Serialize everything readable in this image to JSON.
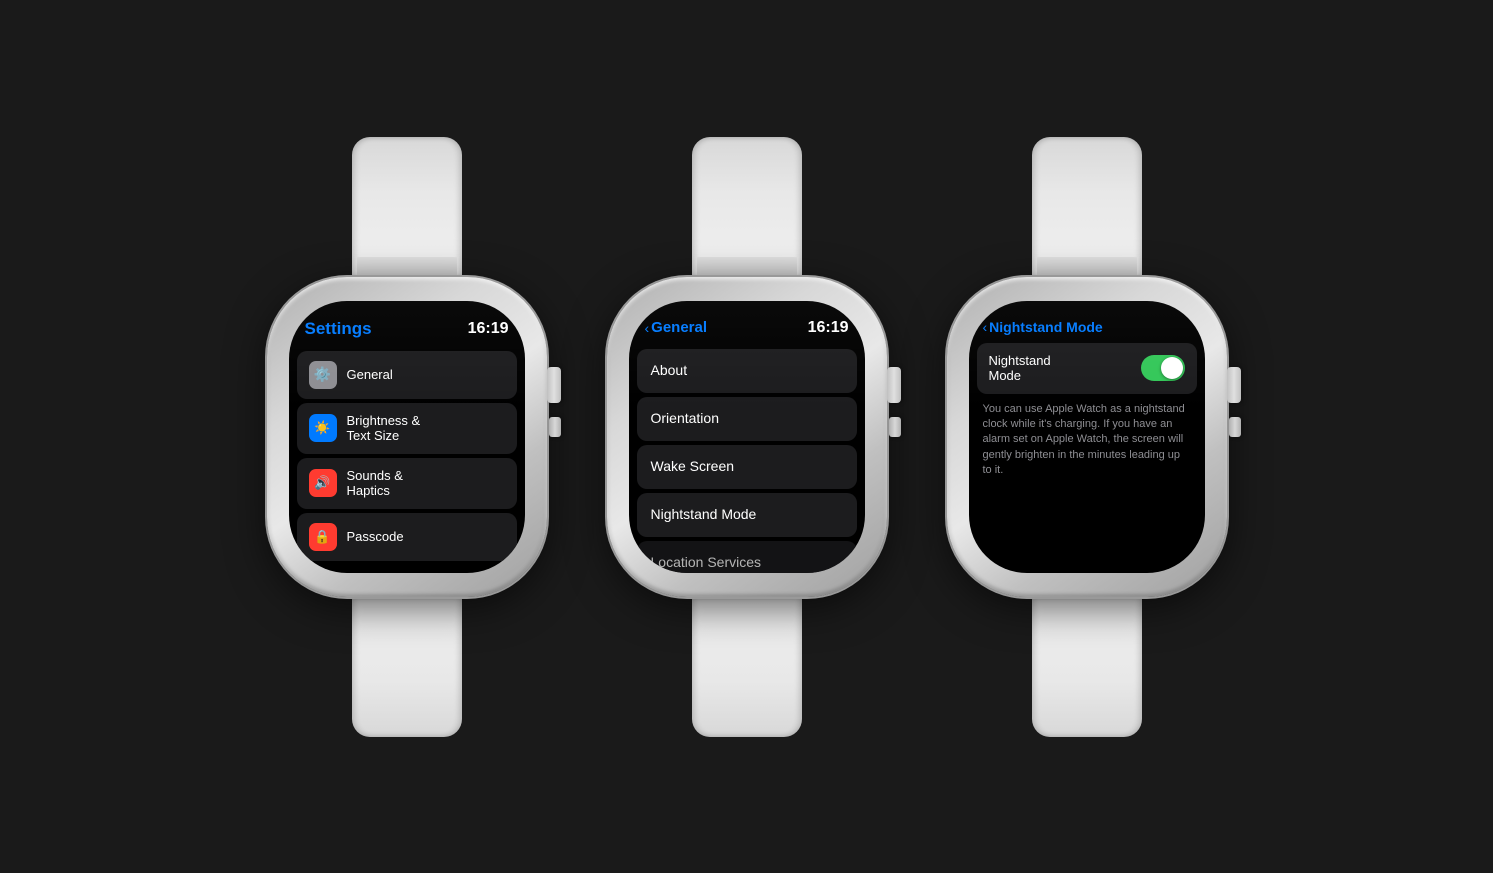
{
  "watches": [
    {
      "id": "watch-settings",
      "screen": {
        "title": "Settings",
        "titleColor": "blue",
        "showBack": false,
        "time": "16:19",
        "menuItems": [
          {
            "label": "General",
            "iconBg": "gray",
            "iconSymbol": "⚙"
          },
          {
            "label": "Brightness &\nText Size",
            "iconBg": "blue",
            "iconSymbol": "☀"
          },
          {
            "label": "Sounds &\nHaptics",
            "iconBg": "red",
            "iconSymbol": "🔊"
          },
          {
            "label": "Passcode",
            "iconBg": "red",
            "iconSymbol": "🔒"
          }
        ]
      }
    },
    {
      "id": "watch-general",
      "screen": {
        "title": "General",
        "titleColor": "blue",
        "showBack": true,
        "time": "16:19",
        "simpleMenuItems": [
          "About",
          "Orientation",
          "Wake Screen",
          "Nightstand Mode",
          "Location Services"
        ]
      }
    },
    {
      "id": "watch-nightstand",
      "screen": {
        "title": "Nightstand Mode",
        "titleColor": "blue",
        "showBack": true,
        "toggleLabel": "Nightstand\nMode",
        "toggleOn": true,
        "description": "You can use Apple Watch as a nightstand clock while it's charging. If you have an alarm set on Apple Watch, the screen will gently brighten in the minutes leading up to it."
      }
    }
  ],
  "icons": {
    "general": "⚙",
    "brightness": "☀",
    "sounds": "🔊",
    "passcode": "🔒",
    "back": "‹"
  },
  "colors": {
    "blue": "#007AFF",
    "green": "#34C759",
    "red": "#FF3B30",
    "dark_item": "#1c1c1e",
    "screen_bg": "#000000"
  }
}
